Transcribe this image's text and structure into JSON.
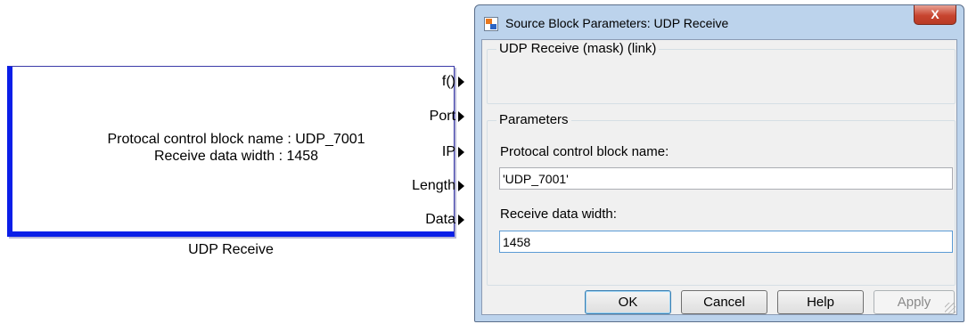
{
  "block": {
    "lines": [
      "Protocal control block name : UDP_7001",
      "Receive data width : 1458"
    ],
    "ports": [
      "f()",
      "Port",
      "IP",
      "Length",
      "Data"
    ],
    "caption": "UDP Receive"
  },
  "dialog": {
    "title": "Source Block Parameters: UDP Receive",
    "close_glyph": "X",
    "description_group": "UDP Receive (mask) (link)",
    "parameters_group": "Parameters",
    "fields": [
      {
        "label": "Protocal control block name:",
        "value": "'UDP_7001'"
      },
      {
        "label": "Receive data width:",
        "value": "1458"
      }
    ],
    "buttons": {
      "ok": "OK",
      "cancel": "Cancel",
      "help": "Help",
      "apply": "Apply"
    }
  },
  "colors": {
    "block_border": "#0a1ee8",
    "dialog_frame": "#bcd3ec",
    "close_button": "#c7442f"
  }
}
